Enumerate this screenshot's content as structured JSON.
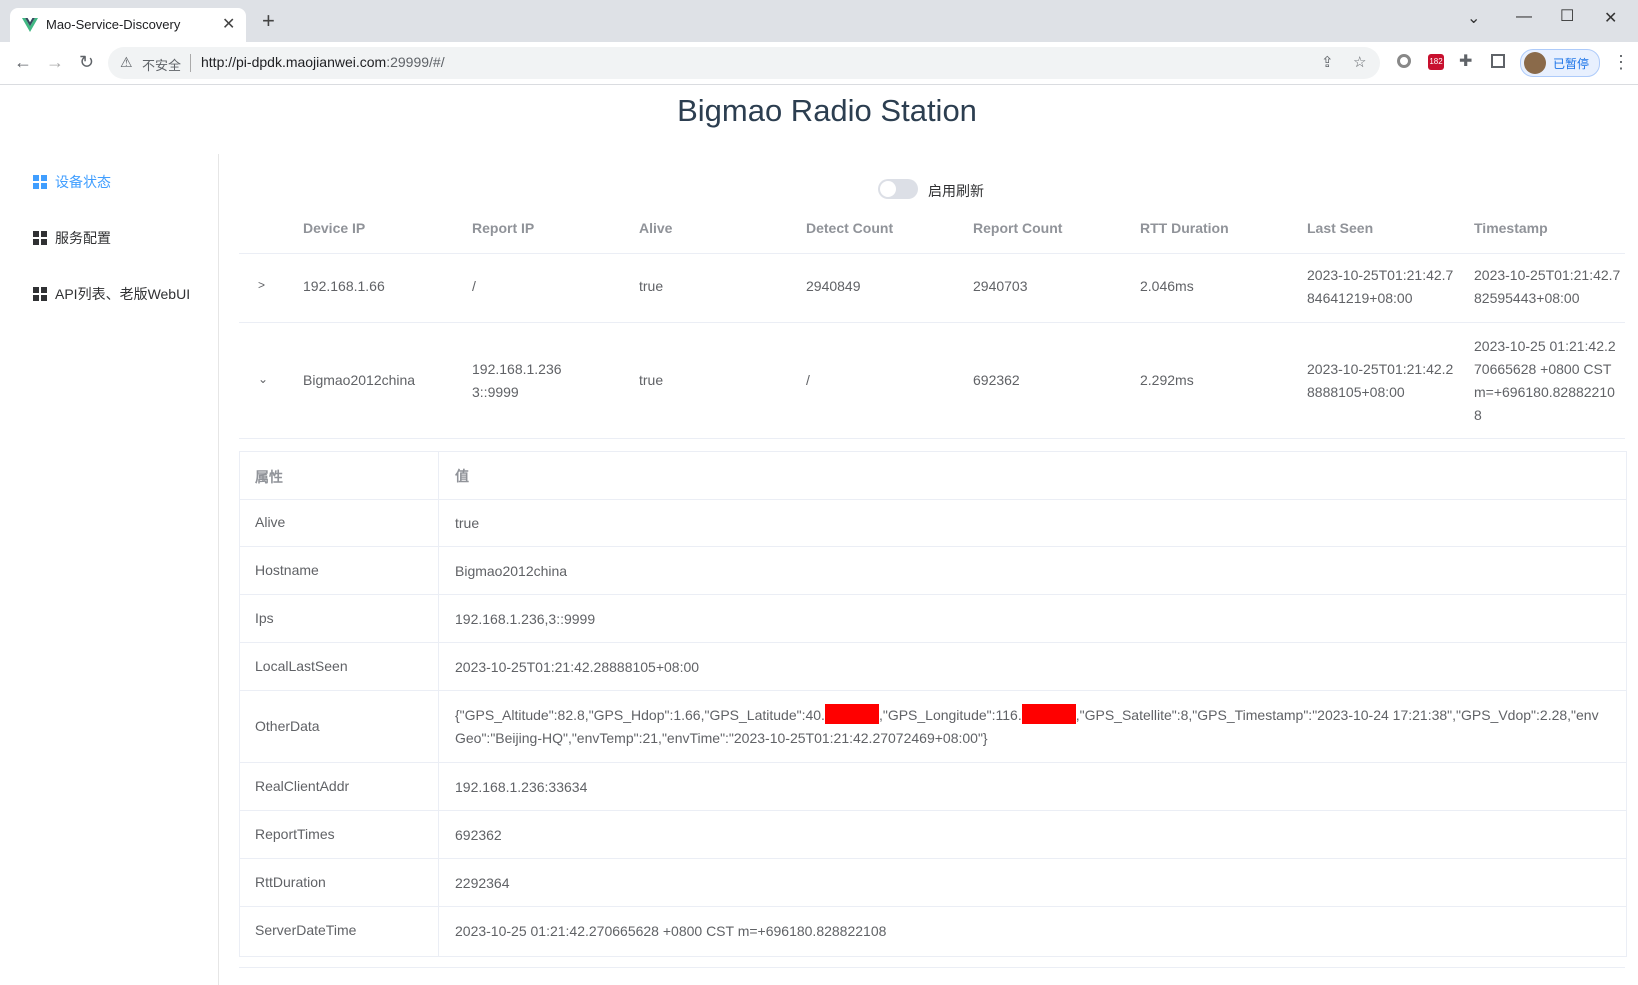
{
  "browser": {
    "tab_title": "Mao-Service-Discovery",
    "insecure_label": "不安全",
    "url_host": "http://pi-dpdk.maojianwei.com",
    "url_rest": ":29999/#/",
    "ext_badge": "182",
    "profile_label": "已暂停"
  },
  "page": {
    "title": "Bigmao Radio Station"
  },
  "sidebar": {
    "items": [
      {
        "label": "设备状态"
      },
      {
        "label": "服务配置"
      },
      {
        "label": "API列表、老版WebUI"
      }
    ]
  },
  "refresh_toggle": {
    "label": "启用刷新",
    "on": false
  },
  "table": {
    "headers": [
      "Device IP",
      "Report IP",
      "Alive",
      "Detect Count",
      "Report Count",
      "RTT Duration",
      "Last Seen",
      "Timestamp"
    ],
    "rows": [
      {
        "device_ip": "192.168.1.66",
        "report_ip": "/",
        "alive": "true",
        "detect_count": "2940849",
        "report_count": "2940703",
        "rtt": "2.046ms",
        "last_seen": "2023-10-25T01:21:42.784641219+08:00",
        "timestamp": "2023-10-25T01:21:42.782595443+08:00",
        "expanded": false
      },
      {
        "device_ip": "Bigmao2012china",
        "report_ip": "192.168.1.2363::9999",
        "alive": "true",
        "detect_count": "/",
        "report_count": "692362",
        "rtt": "2.292ms",
        "last_seen": "2023-10-25T01:21:42.28888105+08:00",
        "timestamp": "2023-10-25 01:21:42.270665628 +0800 CST m=+696180.828822108",
        "expanded": true
      }
    ]
  },
  "detail": {
    "headers": {
      "key": "属性",
      "value": "值"
    },
    "rows": [
      {
        "key": "Alive",
        "value": "true"
      },
      {
        "key": "Hostname",
        "value": "Bigmao2012china"
      },
      {
        "key": "Ips",
        "value": "192.168.1.236,3::9999"
      },
      {
        "key": "LocalLastSeen",
        "value": "2023-10-25T01:21:42.28888105+08:00"
      },
      {
        "key": "RealClientAddr",
        "value": "192.168.1.236:33634"
      },
      {
        "key": "ReportTimes",
        "value": "692362"
      },
      {
        "key": "RttDuration",
        "value": "2292364"
      },
      {
        "key": "ServerDateTime",
        "value": "2023-10-25 01:21:42.270665628 +0800 CST m=+696180.828822108"
      }
    ],
    "other_data": {
      "key": "OtherData",
      "part1": "{\"GPS_Altitude\":82.8,\"GPS_Hdop\":1.66,\"GPS_Latitude\":40.",
      "part2": ",\"GPS_Longitude\":116.",
      "part3": ",\"GPS_Satellite\":8,\"GPS_Timestamp\":\"2023-10-24 17:21:38\",\"GPS_Vdop\":2.28,\"envGeo\":\"Beijing-HQ\",\"envTemp\":21,\"envTime\":\"2023-10-25T01:21:42.27072469+08:00\"}"
    }
  },
  "colors": {
    "accent": "#409eff",
    "title": "#2c3e50",
    "redaction": "#ff0000"
  }
}
